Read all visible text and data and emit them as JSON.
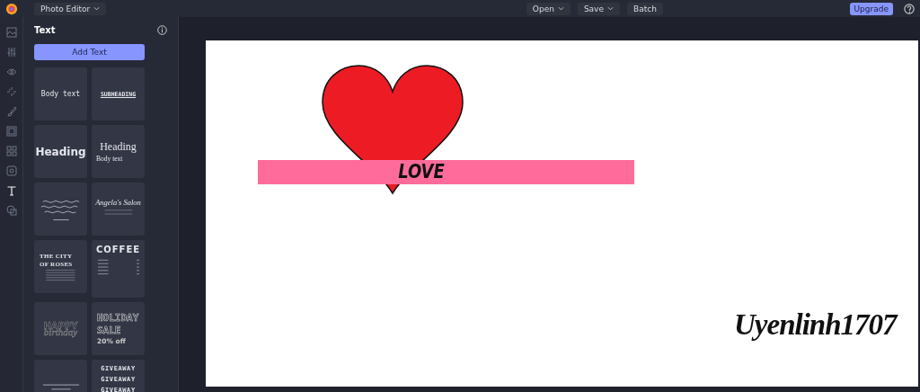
{
  "topbar": {
    "app_menu": "Photo Editor",
    "menus": [
      {
        "label": "Open",
        "has_menu": true
      },
      {
        "label": "Save",
        "has_menu": true
      },
      {
        "label": "Batch",
        "has_menu": false
      }
    ],
    "upgrade": "Upgrade"
  },
  "rail": [
    {
      "selected": false
    },
    {
      "selected": false
    },
    {
      "selected": false
    },
    {
      "selected": false
    },
    {
      "selected": false
    },
    {
      "selected": false
    },
    {
      "selected": false
    },
    {
      "selected": false
    },
    {
      "selected": true
    },
    {
      "selected": false
    }
  ],
  "panel": {
    "title": "Text",
    "add_button": "Add Text",
    "templates": [
      {
        "kind": "mono",
        "lines": [
          "Body text"
        ]
      },
      {
        "kind": "subheading",
        "lines": [
          "SUBHEADING"
        ]
      },
      {
        "kind": "bold",
        "lines": [
          "Heading"
        ]
      },
      {
        "kind": "serif",
        "lines": [
          "Heading",
          "Body text"
        ]
      },
      {
        "kind": "quote"
      },
      {
        "kind": "script",
        "lines": [
          "Angela's Salon"
        ]
      },
      {
        "kind": "city",
        "lines": [
          "THE CITY",
          "OF ROSES"
        ]
      },
      {
        "kind": "coffee",
        "lines": [
          "COFFEE"
        ]
      },
      {
        "kind": "outline",
        "lines": [
          "HAPPY",
          "birthday"
        ]
      },
      {
        "kind": "holiday",
        "lines": [
          "HOLIDAY",
          "SALE",
          "20% off"
        ]
      },
      {
        "kind": "small"
      },
      {
        "kind": "giveaway",
        "lines": [
          "GIVEAWAY",
          "GIVEAWAY",
          "GIVEAWAY"
        ]
      }
    ]
  },
  "canvas": {
    "banner_text": "LOVE",
    "signature": "Uyenlinh1707"
  }
}
